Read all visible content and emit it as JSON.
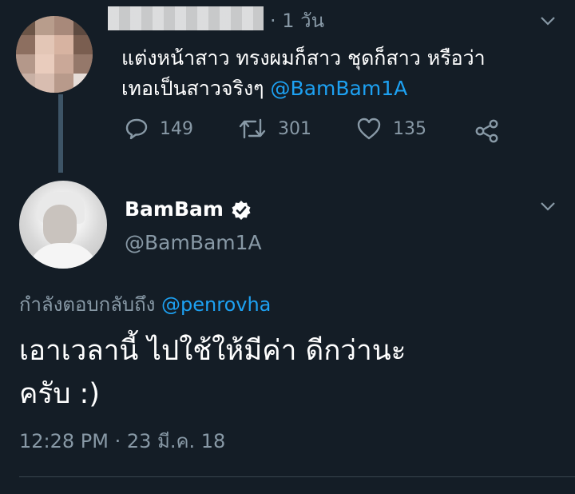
{
  "parent_tweet": {
    "time": "· 1 วัน",
    "text_line1": "แต่งหน้าสาว ทรงผมก็สาว ชุดก็สาว หรือว่า",
    "text_line2_prefix": "เทอเป็นสาวจริงๆ ",
    "text_line2_mention": "@BamBam1A",
    "actions": {
      "replies": "149",
      "retweets": "301",
      "likes": "135"
    }
  },
  "main_tweet": {
    "display_name": "BamBam",
    "handle": "@BamBam1A",
    "replying_label": "กำลังตอบกลับถึง ",
    "replying_to": "@penrovha",
    "body_line1": "เอาเวลานี้ ไปใช้ให้มีค่า ดีกว่านะ",
    "body_line2": "ครับ :)",
    "timestamp": "12:28 PM · 23 มี.ค. 18"
  },
  "icons": [
    "reply-icon",
    "retweet-icon",
    "like-icon",
    "share-icon",
    "verified-badge-icon",
    "chevron-down-icon"
  ],
  "colors": {
    "background": "#141d26",
    "text": "#ffffff",
    "secondary": "#8899a6",
    "link": "#1da1f2"
  }
}
